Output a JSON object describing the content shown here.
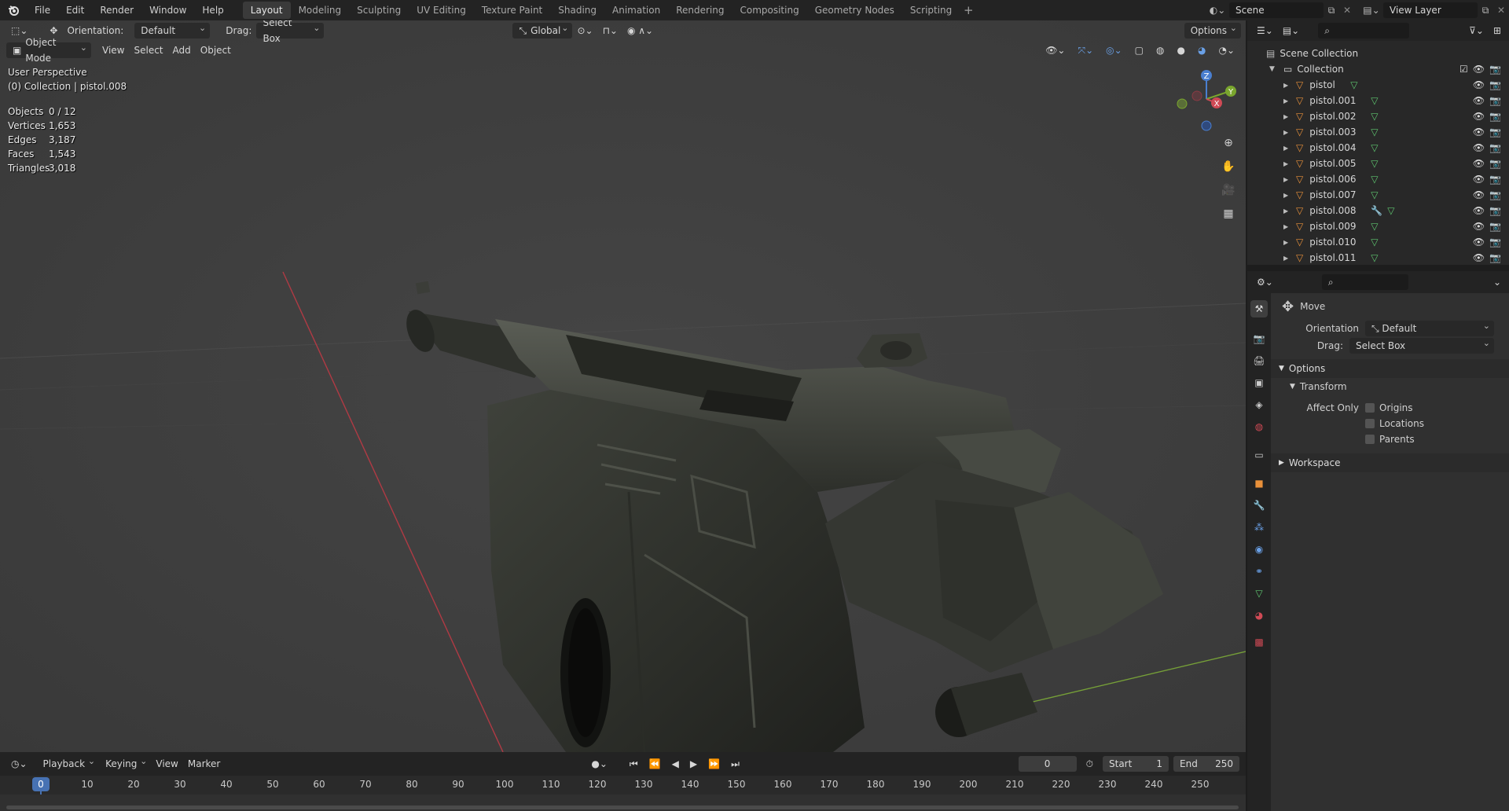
{
  "menu": [
    "File",
    "Edit",
    "Render",
    "Window",
    "Help"
  ],
  "workspaces": [
    "Layout",
    "Modeling",
    "Sculpting",
    "UV Editing",
    "Texture Paint",
    "Shading",
    "Animation",
    "Rendering",
    "Compositing",
    "Geometry Nodes",
    "Scripting"
  ],
  "scene": {
    "name": "Scene",
    "view_layer": "View Layer"
  },
  "viewport": {
    "orientation_label": "Orientation:",
    "orientation_value": "Default",
    "drag_label": "Drag:",
    "drag_value": "Select Box",
    "transform_space": "Global",
    "options_label": "Options",
    "mode": "Object Mode",
    "menus": [
      "View",
      "Select",
      "Add",
      "Object"
    ],
    "perspective": "User Perspective",
    "active_info": "(0) Collection | pistol.008",
    "stats": [
      {
        "label": "Objects",
        "value": "0 / 12"
      },
      {
        "label": "Vertices",
        "value": "1,653"
      },
      {
        "label": "Edges",
        "value": "3,187"
      },
      {
        "label": "Faces",
        "value": "1,543"
      },
      {
        "label": "Triangles",
        "value": "3,018"
      }
    ],
    "gizmo_axes": {
      "x": "X",
      "y": "Y",
      "z": "Z"
    }
  },
  "timeline": {
    "menus": [
      "Playback",
      "Keying",
      "View",
      "Marker"
    ],
    "current_frame": "0",
    "start_label": "Start",
    "start_value": "1",
    "end_label": "End",
    "end_value": "250",
    "frames": [
      "0",
      "10",
      "20",
      "30",
      "40",
      "50",
      "60",
      "70",
      "80",
      "90",
      "100",
      "110",
      "120",
      "130",
      "140",
      "150",
      "160",
      "170",
      "180",
      "190",
      "200",
      "210",
      "220",
      "230",
      "240",
      "250"
    ]
  },
  "outliner": {
    "root": "Scene Collection",
    "collection": "Collection",
    "objects": [
      "pistol",
      "pistol.001",
      "pistol.002",
      "pistol.003",
      "pistol.004",
      "pistol.005",
      "pistol.006",
      "pistol.007",
      "pistol.008",
      "pistol.009",
      "pistol.010",
      "pistol.011"
    ]
  },
  "properties": {
    "tool_name": "Move",
    "orientation_label": "Orientation",
    "orientation_value": "Default",
    "drag_label": "Drag:",
    "drag_value": "Select Box",
    "options_panel": "Options",
    "transform_panel": "Transform",
    "affect_only_label": "Affect Only",
    "affect_options": [
      "Origins",
      "Locations",
      "Parents"
    ],
    "workspace_panel": "Workspace"
  },
  "colors": {
    "accent": "#4772b3",
    "object_orange": "#e8903a",
    "mesh_green": "#5ec46f",
    "axis_red": "#c8404a",
    "axis_green": "#7aa04a"
  }
}
